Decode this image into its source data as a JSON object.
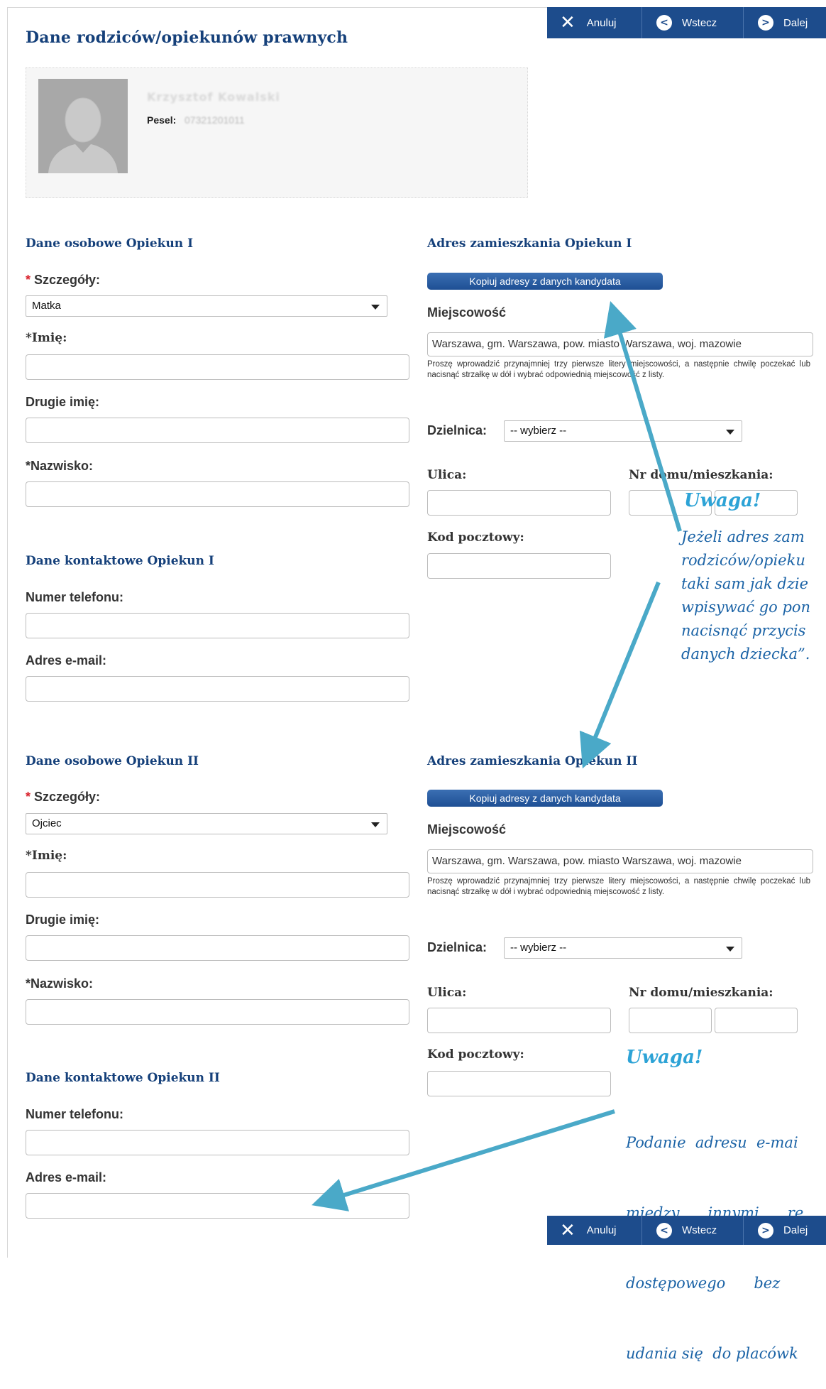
{
  "page_title": "Dane rodziców/opiekunów prawnych",
  "toolbar": {
    "cancel": "Anuluj",
    "back": "Wstecz",
    "next": "Dalej"
  },
  "candidate": {
    "name": "Krzysztof Kowalski",
    "pesel_label": "Pesel:",
    "pesel_value": "07321201011"
  },
  "g1": {
    "personal_title": "Dane osobowe Opiekun I",
    "details_label": "Szczegóły:",
    "details_value": "Matka",
    "first_name_label": "*Imię:",
    "middle_name_label": "Drugie imię:",
    "last_name_label": "*Nazwisko:",
    "contact_title": "Dane kontaktowe Opiekun I",
    "phone_label": "Numer telefonu:",
    "email_label": "Adres e-mail:",
    "address_title": "Adres zamieszkania Opiekun I",
    "copy_button": "Kopiuj adresy z danych kandydata",
    "city_label": "Miejscowość",
    "city_value": "Warszawa, gm. Warszawa, pow. miasto Warszawa, woj. mazowie",
    "city_hint": "Proszę wprowadzić przynajmniej trzy pierwsze litery miejscowości, a następnie chwilę poczekać lub nacisnąć strzałkę w dół i wybrać odpowiednią miejscowość z listy.",
    "district_label": "Dzielnica:",
    "district_value": "-- wybierz --",
    "street_label": "Ulica:",
    "house_label": "Nr domu/mieszkania:",
    "postcode_label": "Kod pocztowy:"
  },
  "g2": {
    "personal_title": "Dane osobowe Opiekun II",
    "details_label": "Szczegóły:",
    "details_value": "Ojciec",
    "first_name_label": "*Imię:",
    "middle_name_label": "Drugie imię:",
    "last_name_label": "*Nazwisko:",
    "contact_title": "Dane kontaktowe Opiekun II",
    "phone_label": "Numer telefonu:",
    "email_label": "Adres e-mail:",
    "address_title": "Adres zamieszkania Opiekun II",
    "copy_button": "Kopiuj adresy z danych kandydata",
    "city_label": "Miejscowość",
    "city_value": "Warszawa, gm. Warszawa, pow. miasto Warszawa, woj. mazowie",
    "city_hint": "Proszę wprowadzić przynajmniej trzy pierwsze litery miejscowości, a następnie chwilę poczekać lub nacisnąć strzałkę w dół i wybrać odpowiednią miejscowość z listy.",
    "district_label": "Dzielnica:",
    "district_value": "-- wybierz --",
    "street_label": "Ulica:",
    "house_label": "Nr domu/mieszkania:",
    "postcode_label": "Kod pocztowy:"
  },
  "note1": {
    "title": "Uwaga!",
    "lines": [
      "Jeżeli adres zam",
      "rodziców/opieku",
      "taki sam jak dzie",
      "wpisywać go pon",
      "nacisnąć przycis",
      "danych dziecka”."
    ]
  },
  "note2": {
    "title": "Uwaga!",
    "lines": [
      "Podanie  adresu  e-mai",
      "między      innymi      re",
      "dostępowego      bez      ",
      "udania się  do placówk"
    ]
  },
  "colors": {
    "accent": "#15407a",
    "toolbar": "#1d4c8c",
    "note_title": "#2da3d6",
    "note_text": "#1b63a6",
    "arrow": "#4aa9c8",
    "required": "#d9232d"
  }
}
